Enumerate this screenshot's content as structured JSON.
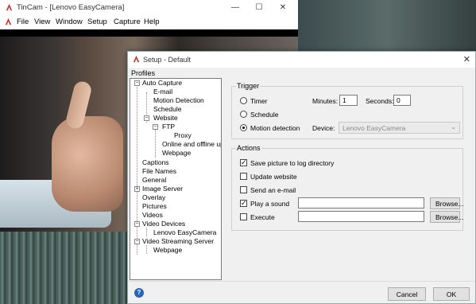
{
  "main_window": {
    "title": "TinCam - [Lenovo EasyCamera]",
    "controls": {
      "minimize": "—",
      "maximize": "☐",
      "close": "✕"
    },
    "menu": [
      "File",
      "View",
      "Window",
      "Setup",
      "Capture",
      "Help"
    ]
  },
  "dialog": {
    "title": "Setup - Default",
    "close": "✕",
    "profiles_label": "Profiles",
    "tree": [
      {
        "label": "Auto Capture",
        "level": 0
      },
      {
        "label": "E-mail",
        "level": 1
      },
      {
        "label": "Motion Detection",
        "level": 1
      },
      {
        "label": "Schedule",
        "level": 1
      },
      {
        "label": "Website",
        "level": 1
      },
      {
        "label": "FTP",
        "level": 2
      },
      {
        "label": "Proxy",
        "level": 3
      },
      {
        "label": "Online and offline uplo",
        "level": 2
      },
      {
        "label": "Webpage",
        "level": 2
      },
      {
        "label": "Captions",
        "level": 0
      },
      {
        "label": "File Names",
        "level": 0
      },
      {
        "label": "General",
        "level": 0
      },
      {
        "label": "Image Server",
        "level": 0
      },
      {
        "label": "Overlay",
        "level": 0
      },
      {
        "label": "Pictures",
        "level": 0
      },
      {
        "label": "Videos",
        "level": 0
      },
      {
        "label": "Video Devices",
        "level": 0
      },
      {
        "label": "Lenovo EasyCamera",
        "level": 1
      },
      {
        "label": "Video Streaming Server",
        "level": 0
      },
      {
        "label": "Webpage",
        "level": 1
      }
    ],
    "trigger": {
      "title": "Trigger",
      "timer_label": "Timer",
      "schedule_label": "Schedule",
      "motion_label": "Motion detection",
      "selected": "Motion detection",
      "minutes_label": "Minutes:",
      "minutes_value": "1",
      "seconds_label": "Seconds:",
      "seconds_value": "0",
      "device_label": "Device:",
      "device_value": "Lenovo EasyCamera"
    },
    "actions": {
      "title": "Actions",
      "save_label": "Save picture to log directory",
      "save_checked": true,
      "update_label": "Update website",
      "update_checked": false,
      "email_label": "Send an e-mail",
      "email_checked": false,
      "sound_label": "Play a sound",
      "sound_checked": true,
      "sound_path": "",
      "execute_label": "Execute",
      "execute_checked": false,
      "execute_path": "",
      "browse_label": "Browse..."
    },
    "footer": {
      "help_icon_text": "?",
      "cancel_label": "Cancel",
      "ok_label": "OK"
    }
  },
  "colors": {
    "accent_red": "#c4302b",
    "help_blue": "#2a64b5"
  }
}
